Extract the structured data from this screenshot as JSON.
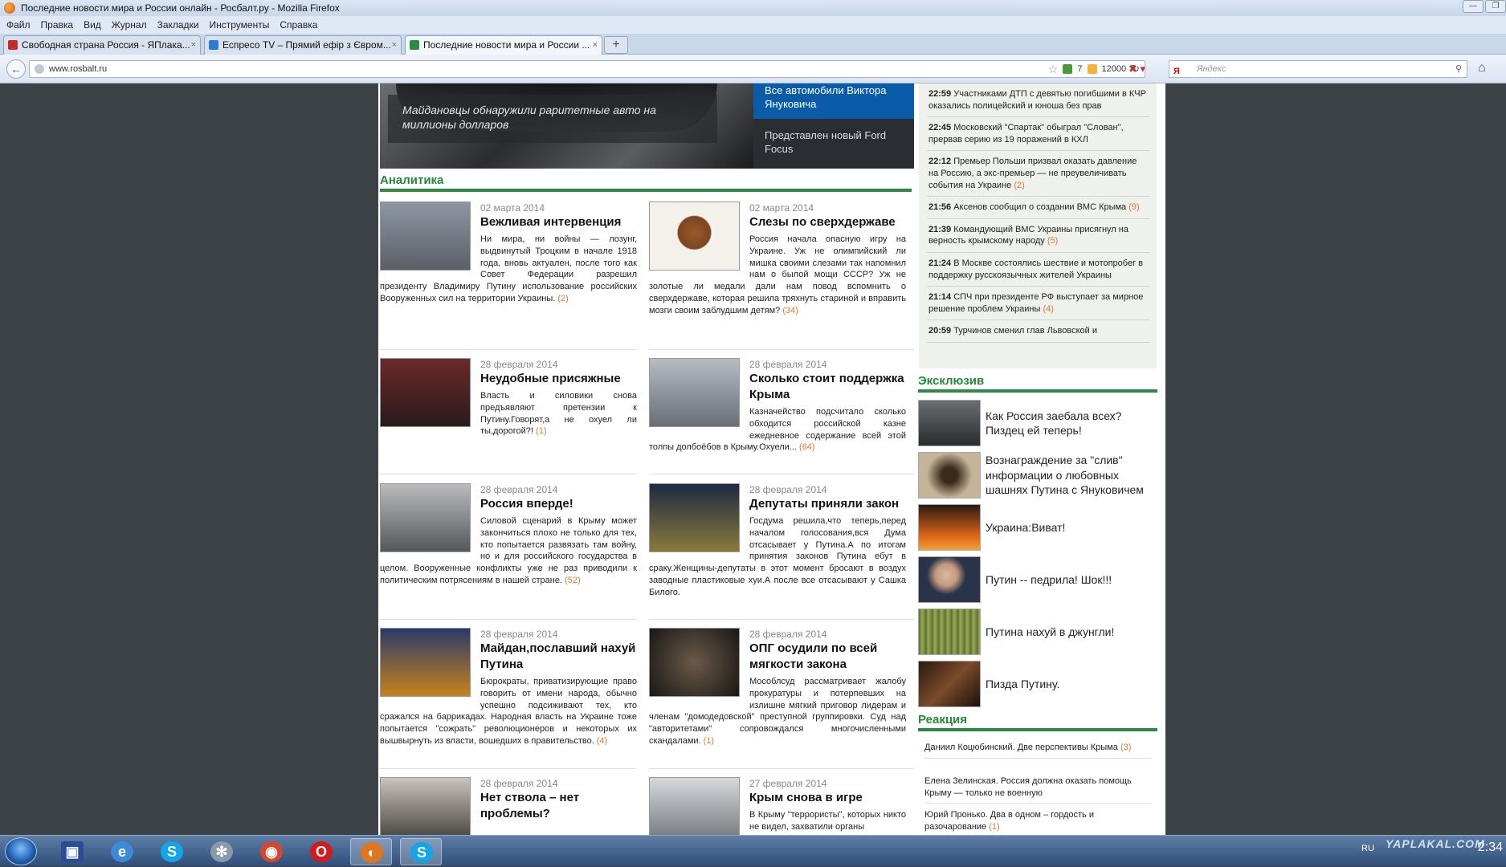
{
  "window": {
    "title": "Последние новости мира и России онлайн - Росбалт.ру - Mozilla Firefox",
    "min": "—",
    "max": "❐"
  },
  "menu": [
    "Файл",
    "Правка",
    "Вид",
    "Журнал",
    "Закладки",
    "Инструменты",
    "Справка"
  ],
  "tabs": [
    {
      "label": "Свободная страна Россия - ЯПлака...",
      "close": "×",
      "favicon_color": "#c62b2b"
    },
    {
      "label": "Еспресо TV – Прямий ефір з Євром...",
      "close": "×",
      "favicon_color": "#2e7ad1"
    },
    {
      "label": "Последние новости мира и России ...",
      "close": "×",
      "favicon_color": "#2a8c40"
    }
  ],
  "newtab": "+",
  "nav": {
    "back": "←",
    "url": "www.rosbalt.ru",
    "star": "☆",
    "badge1": "7",
    "badge2": "12000",
    "refresh": "↻",
    "search_placeholder": "Яндекс",
    "search_logo": "Я",
    "search_icon": "⚲",
    "home": "⌂"
  },
  "hero": {
    "caption": "Майдановцы обнаружили раритетные авто на миллионы долларов",
    "side1": "Все автомобили Виктора Януковича",
    "side2": "Представлен новый Ford Focus"
  },
  "sections": {
    "analytics": "Аналитика",
    "exclusive": "Эксклюзив",
    "reaction": "Реакция"
  },
  "articles": [
    {
      "date": "02 марта 2014",
      "title": "Вежливая интервенция",
      "text": "Ни мира, ни войны — лозунг, выдвинутый Троцким в начале 1918 года, вновь актуален, после того как Совет Федерации разрешил президенту Владимиру Путину использование российских Вооруженных сил на территории Украины.",
      "count": "(2)",
      "thumb": "#7a7f86"
    },
    {
      "date": "02 марта 2014",
      "title": "Слезы по сверхдержаве",
      "text": "Россия начала опасную игру на Украине. Уж не олимпийский ли мишка своими слезами так напомнил нам о былой мощи СССР? Уж не золотые ли медали дали нам повод вспомнить о сверхдержаве, которая решила тряхнуть стариной и вправить мозги своим заблудшим детям?",
      "count": "(34)",
      "thumb": "#f4f0ea"
    },
    {
      "date": "28 февраля 2014",
      "title": "Неудобные присяжные",
      "text": "Власть и силовики снова предъявляют претензии к Путину.Говорят,а не охуел ли ты,дорогой?!",
      "count": "(1)",
      "thumb": "#5a2a2a"
    },
    {
      "date": "28 февраля 2014",
      "title": "Сколько стоит поддержка Крыма",
      "text": "Казначейство подсчитало сколько обходится российской казне ежедневное содержание всей этой толпы долбоёбов в Крыму.Охуели...",
      "count": "(64)",
      "thumb": "#8a8f95"
    },
    {
      "date": "28 февраля 2014",
      "title": "Россия вперде!",
      "text": "Силовой сценарий в Крыму может закончиться плохо не только для тех, кто попытается развязать там войну, но и для российского государства в целом. Вооруженные конфликты уже не раз приводили к политическим потрясениям в нашей стране.",
      "count": "(52)",
      "thumb": "#9a9c9e"
    },
    {
      "date": "28 февраля 2014",
      "title": "Депутаты приняли закон",
      "text": "Госдума решила,что теперь,перед началом голосования,вся Дума отсасывает у Путина.А по итогам принятия законов Путина ебут в сраку.Женщины-депутаты в этот момент бросают в воздух заводные пластиковые хуи.А после все отсасывают у Сашка Билого.",
      "count": "",
      "thumb": "#3a3527"
    },
    {
      "date": "28 февраля 2014",
      "title": "Майдан,пославший нахуй Путина",
      "text": "Бюрократы, приватизирующие право говорить от имени народа, обычно успешно подсиживают тех, кто сражался на баррикадах. Народная власть на Украине тоже попытается \"сожрать\" революционеров и некоторых их вышвырнуть из власти, вошедших в правительство.",
      "count": "(4)",
      "thumb": "#3a2d1a"
    },
    {
      "date": "28 февраля 2014",
      "title": "ОПГ осудили по всей мягкости закона",
      "text": "Мособлсуд рассматривает жалобу прокуратуры и потерпевших на излишне мягкий приговор лидерам и членам \"домодедовской\" преступной группировки. Суд над \"авторитетами\" сопровождался многочисленными скандалами.",
      "count": "(1)",
      "thumb": "#2b2622"
    },
    {
      "date": "28 февраля 2014",
      "title": "Нет ствола – нет проблемы?",
      "text": "",
      "count": "",
      "thumb": "#7c7a74"
    },
    {
      "date": "27 февраля 2014",
      "title": "Крым снова в игре",
      "text": "В Крыму \"террористы\", которых никто не видел, захватили органы",
      "count": "",
      "thumb": "#a4a8ac"
    }
  ],
  "newsfeed": [
    {
      "time": "22:59",
      "text": "Участниками ДТП с девятью погибшими в КЧР оказались полицейский и юноша без прав",
      "count": ""
    },
    {
      "time": "22:45",
      "text": "Московский \"Спартак\" обыграл \"Слован\", прервав серию из 19 поражений в КХЛ",
      "count": ""
    },
    {
      "time": "22:12",
      "text": "Премьер Польши призвал оказать давление на Россию, а экс-премьер — не преувеличивать события на Украине",
      "count": "(2)"
    },
    {
      "time": "21:56",
      "text": "Аксенов сообщил о создании ВМС Крыма",
      "count": "(9)"
    },
    {
      "time": "21:39",
      "text": "Командующий ВМС Украины присягнул на верность крымскому народу",
      "count": "(5)"
    },
    {
      "time": "21:24",
      "text": "В Москве состоялись шествие и мотопробег в поддержку русскоязычных жителей Украины",
      "count": ""
    },
    {
      "time": "21:14",
      "text": "СПЧ при президенте РФ выступает за мирное решение проблем Украины",
      "count": "(4)"
    },
    {
      "time": "20:59",
      "text": "Турчинов сменил глав Львовской и",
      "count": ""
    }
  ],
  "exclusive": [
    {
      "text": "Как Россия заебала всех? Пиздец ей теперь!",
      "thumb": "#4a4e52"
    },
    {
      "text": "Вознаграждение за \"слив\" информации о любовных шашнях Путина с Януковичем",
      "thumb": "#c4b49a"
    },
    {
      "text": "Украина:Виват!",
      "thumb": "#b04a14"
    },
    {
      "text": "Путин -- педрила! Шок!!!",
      "thumb": "#6e7b8a"
    },
    {
      "text": "Путина нахуй в джунгли!",
      "thumb": "#7b8a45"
    },
    {
      "text": "Пизда Путину.",
      "thumb": "#5a3a22"
    }
  ],
  "reaction": [
    {
      "text": "Даниил Коцюбинский. Две перспективы Крыма",
      "count": "(3)"
    },
    {
      "text": "Елена Зелинская. Россия должна оказать помощь Крыму — только не военную",
      "count": ""
    },
    {
      "text": "Юрий Пронько. Два в одном – гордость и разочарование",
      "count": "(1)"
    }
  ],
  "taskbar": {
    "apps": [
      {
        "name": "save-app",
        "glyph": "▣",
        "color": "#2a4d9a"
      },
      {
        "name": "ie-app",
        "glyph": "e",
        "color": "#3a8ad8"
      },
      {
        "name": "skype-app",
        "glyph": "S",
        "color": "#12a5e8"
      },
      {
        "name": "safari-app",
        "glyph": "✻",
        "color": "#8a9aa8"
      },
      {
        "name": "chrome-app",
        "glyph": "◉",
        "color": "#d8452f"
      },
      {
        "name": "opera-app",
        "glyph": "O",
        "color": "#d41a1a"
      },
      {
        "name": "firefox-app",
        "glyph": "◐",
        "color": "#e0751f"
      },
      {
        "name": "skype2-app",
        "glyph": "S",
        "color": "#12a5e8"
      }
    ],
    "lang": "RU",
    "clock": "2:34",
    "watermark": "YAPLAKAL.COM"
  }
}
